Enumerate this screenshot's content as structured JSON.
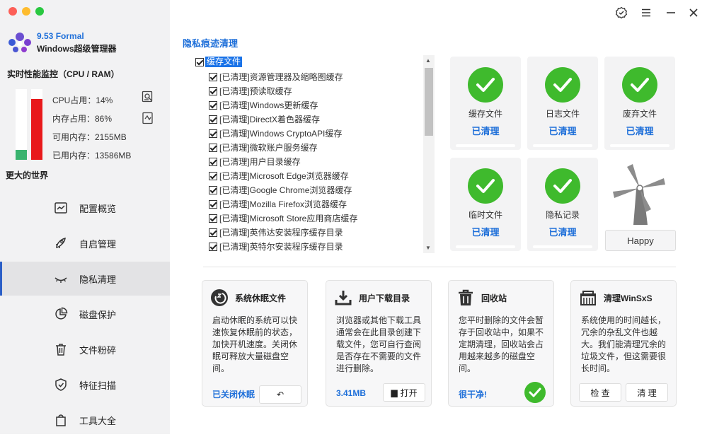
{
  "app": {
    "version": "9.53 Formal",
    "name": "Windows超级管理器"
  },
  "monitor": {
    "title": "实时性能监控（CPU / RAM）",
    "cpu_label": "CPU占用：14%",
    "mem_label": "内存占用：86%",
    "avail_label": "可用内存：2155MB",
    "used_label": "已用内存：13586MB",
    "cpu_fraction": 0.14,
    "mem_fraction": 0.86,
    "cpu_color": "#39b36e",
    "mem_color": "#e8191b"
  },
  "world": "更大的世界",
  "nav": [
    {
      "label": "配置概览",
      "icon": "chart-icon"
    },
    {
      "label": "自启管理",
      "icon": "rocket-icon"
    },
    {
      "label": "隐私清理",
      "icon": "eye-closed-icon"
    },
    {
      "label": "磁盘保护",
      "icon": "pie-icon"
    },
    {
      "label": "文件粉碎",
      "icon": "trash-icon"
    },
    {
      "label": "特征扫描",
      "icon": "shield-icon"
    },
    {
      "label": "工具大全",
      "icon": "bag-icon"
    }
  ],
  "section_title": "隐私痕迹清理",
  "tree": {
    "root": "缓存文件",
    "items": [
      "[已清理]资源管理器及缩略图缓存",
      "[已清理]预读取缓存",
      "[已清理]Windows更新缓存",
      "[已清理]DirectX着色器缓存",
      "[已清理]Windows CryptoAPI缓存",
      "[已清理]微软账户服务缓存",
      "[已清理]用户目录缓存",
      "[已清理]Microsoft Edge浏览器缓存",
      "[已清理]Google Chrome浏览器缓存",
      "[已清理]Mozilla Firefox浏览器缓存",
      "[已清理]Microsoft Store应用商店缓存",
      "[已清理]英伟达安装程序缓存目录",
      "[已清理]英特尔安装程序缓存目录"
    ]
  },
  "cards": [
    {
      "name": "缓存文件",
      "status": "已清理"
    },
    {
      "name": "日志文件",
      "status": "已清理"
    },
    {
      "name": "废弃文件",
      "status": "已清理"
    },
    {
      "name": "临时文件",
      "status": "已清理"
    },
    {
      "name": "隐私记录",
      "status": "已清理"
    }
  ],
  "happy": "Happy",
  "bottom": [
    {
      "title": "系统休眠文件",
      "desc": "启动休眠的系统可以快速恢复休眠前的状态，加快开机速度。关闭休眠可释放大量磁盘空间。",
      "foot": "已关闭休眠",
      "btn": "↶"
    },
    {
      "title": "用户下载目录",
      "desc": "浏览器或其他下载工具通常会在此目录创建下载文件，您可自行查阅是否存在不需要的文件进行删除。",
      "foot": "3.41MB",
      "btn": "打开"
    },
    {
      "title": "回收站",
      "desc": "您平时删除的文件会暂存于回收站中，如果不定期清理，回收站会占用越来越多的磁盘空间。",
      "foot": "很干净!"
    },
    {
      "title": "清理WinSxS",
      "desc": "系统使用的时间越长，冗余的杂乱文件也越大。我们能清理冗余的垃圾文件，但这需要很长时间。",
      "btn1": "检 查",
      "btn2": "清 理"
    }
  ]
}
